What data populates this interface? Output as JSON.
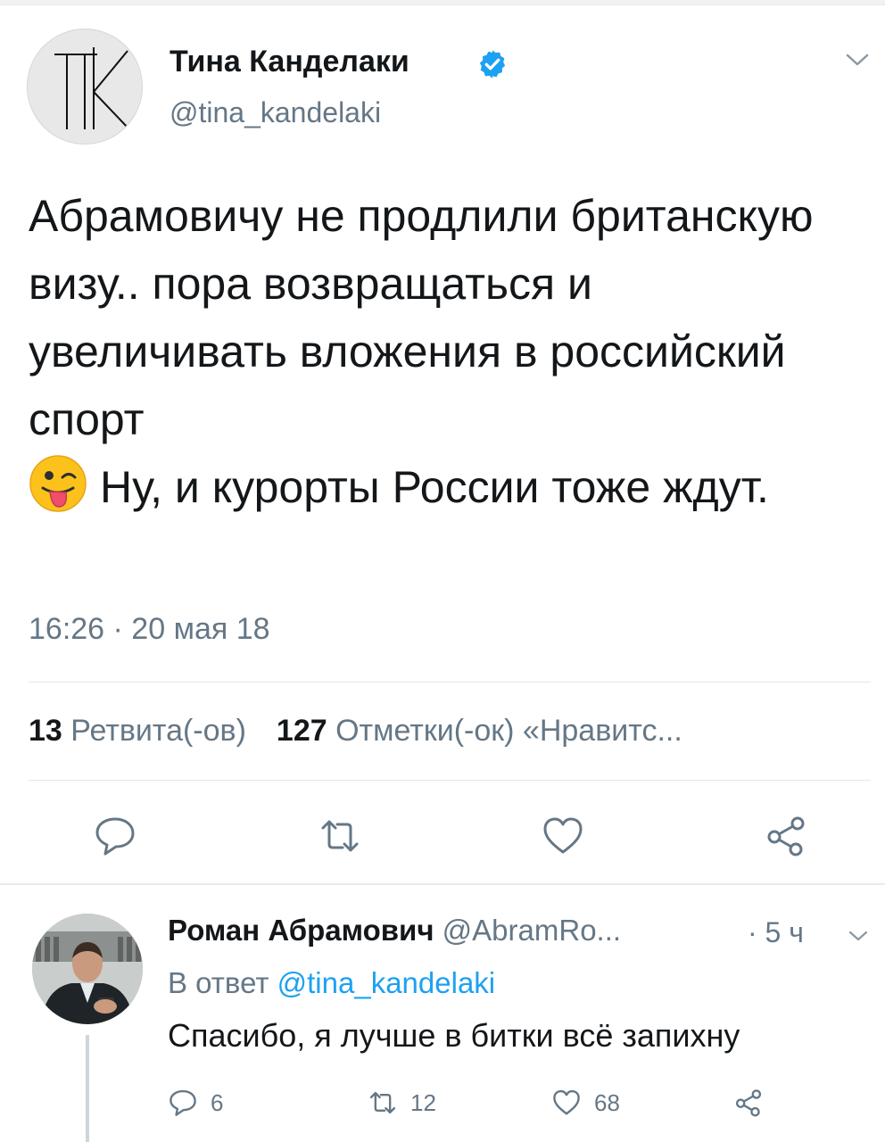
{
  "tweet": {
    "author_name": "Тина Канделаки",
    "author_handle": "@tina_kandelaki",
    "avatar_monogram": "TK",
    "text_before_emoji": "Абрамовичу не продлили британскую визу.. пора возвращаться и увеличивать вложения в российский спорт",
    "emoji": "winking-face-with-tongue",
    "text_after_emoji": "Ну, и курорты России тоже ждут.",
    "timestamp": "16:26 · 20 мая 18",
    "retweets_count": "13",
    "retweets_label": "Ретвита(-ов)",
    "likes_count": "127",
    "likes_label": "Отметки(-ок) «Нравитс..."
  },
  "reply": {
    "author_name": "Роман Абрамович",
    "author_handle": "@AbramRo...",
    "time": "· 5 ч",
    "in_reply_prefix": "В ответ",
    "in_reply_mention": "@tina_kandelaki",
    "text": "Спасибо, я лучше в битки всё запихну",
    "replies_count": "6",
    "retweets_count": "12",
    "likes_count": "68"
  },
  "colors": {
    "verified": "#1da1f2",
    "mention": "#1da1f2",
    "secondary_text": "#657786",
    "icon_gray": "#657786"
  }
}
